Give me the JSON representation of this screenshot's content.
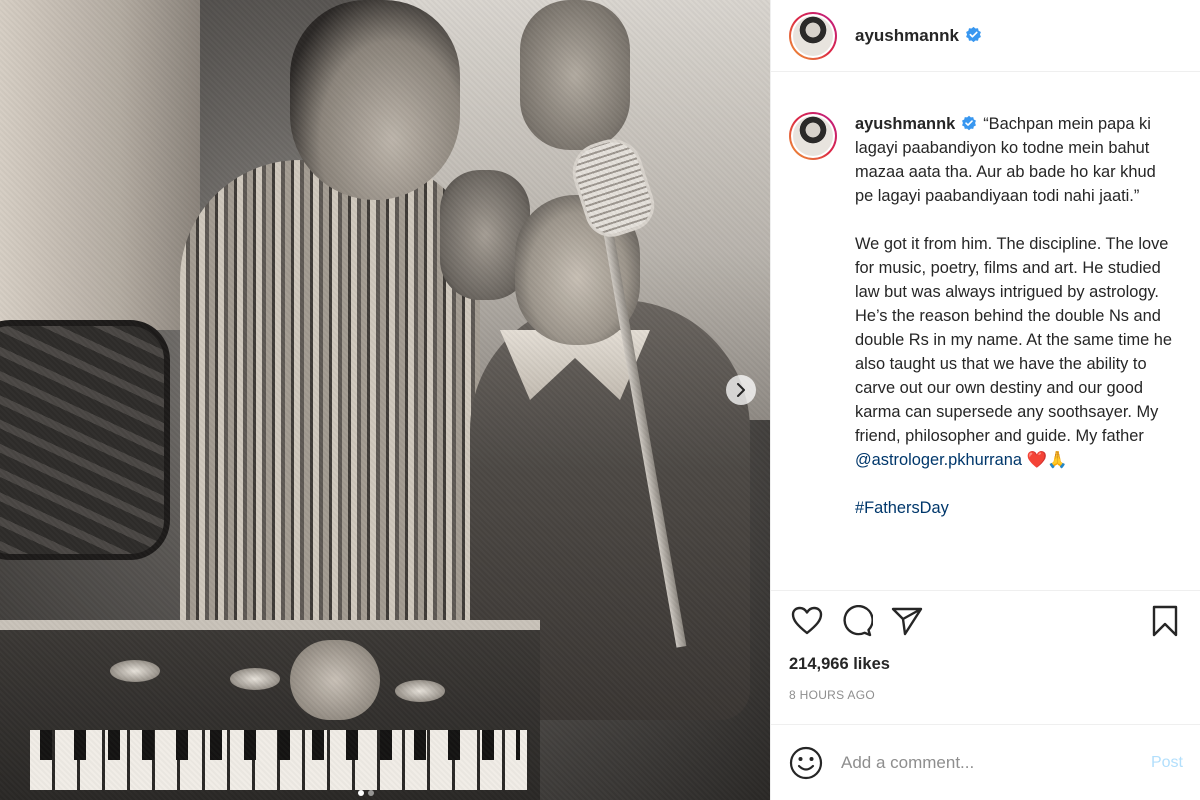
{
  "post": {
    "username": "ayushmannk",
    "caption_quote": "“Bachpan mein papa ki lagayi paabandiyon ko todne mein bahut mazaa aata tha. Aur ab bade ho kar khud pe lagayi paabandiyaan todi nahi jaati.”",
    "caption_body": "We got it from him. The discipline. The love for music, poetry, films and art. He studied law but was always intrigued by astrology. He’s the reason behind the double Ns and double Rs in my name. At the same time he also taught us that we have the ability to carve out our own destiny and our good karma can supersede any soothsayer. My friend, philosopher and guide. My father",
    "mention": "@astrologer.pkhurrana",
    "emojis": "❤️🙏",
    "hashtag": "#FathersDay",
    "likes": "214,966 likes",
    "time_ago": "8 HOURS AGO",
    "comment_placeholder": "Add a comment...",
    "post_button": "Post"
  },
  "carousel": {
    "dot_count": 2,
    "active_index": 0
  },
  "colors": {
    "verified": "#3897f0",
    "link": "#00376b",
    "heart": "#ed4956",
    "post_disabled": "#b2dffc"
  },
  "icons": [
    "heart-icon",
    "comment-icon",
    "share-icon",
    "bookmark-icon",
    "emoji-icon",
    "chevron-right-icon",
    "verified-badge-icon"
  ]
}
